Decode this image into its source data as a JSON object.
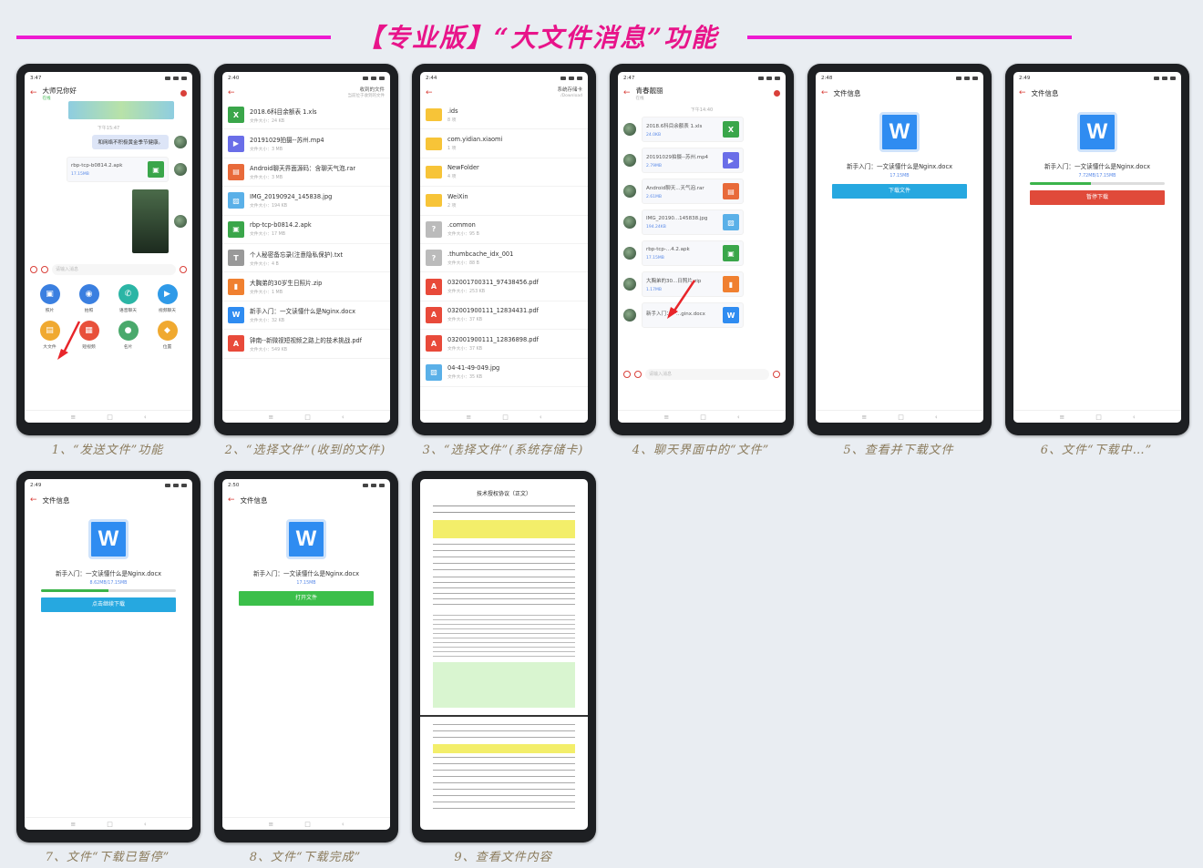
{
  "banner": {
    "title": "【专业版】“大文件消息”功能"
  },
  "captions": [
    "1、“发送文件”功能",
    "2、“选择文件”(收到的文件)",
    "3、“选择文件”(系统存储卡)",
    "4、聊天界面中的“文件”",
    "5、查看并下载文件",
    "6、文件“下载中…”",
    "7、文件“下载已暂停”",
    "8、文件“下载完成”",
    "9、查看文件内容"
  ],
  "nav": {
    "menu": "≡",
    "home": "□",
    "back": "‹"
  },
  "screen1": {
    "clock": "3:47",
    "title": "大师兄你好",
    "subtitle": "在线",
    "time": "下午15:47",
    "text_msg": "和网络不积极黄金季节健康。",
    "file_name": "rbp-tcp-b0814.2.apk",
    "file_size": "17.15MB",
    "input_placeholder": "请输入消息",
    "actions": [
      {
        "label": "照片",
        "color": "#3a7fe0",
        "glyph": "▣"
      },
      {
        "label": "拍照",
        "color": "#3a7fe0",
        "glyph": "◉"
      },
      {
        "label": "语音聊天",
        "color": "#2bb5a5",
        "glyph": "✆"
      },
      {
        "label": "视频聊天",
        "color": "#2f9ae8",
        "glyph": "▶"
      },
      {
        "label": "大文件",
        "color": "#f0a930",
        "glyph": "▤"
      },
      {
        "label": "短视频",
        "color": "#e8503a",
        "glyph": "▦"
      },
      {
        "label": "名片",
        "color": "#4aa96c",
        "glyph": "●"
      },
      {
        "label": "位置",
        "color": "#f0a930",
        "glyph": "◆"
      }
    ]
  },
  "screen2": {
    "clock": "2:40",
    "title": "收到的文件",
    "subtitle": "当前位于收到的文件",
    "files": [
      {
        "name": "2018.6科目余额表 1.xls",
        "size": "文件大小：24 KB",
        "color": "#3aa64a",
        "glyph": "X"
      },
      {
        "name": "20191029拍摄--苏州.mp4",
        "size": "文件大小：3 MB",
        "color": "#6a6ee8",
        "glyph": "▶"
      },
      {
        "name": "Android聊天界面源码：含聊天气泡.rar",
        "size": "文件大小：3 MB",
        "color": "#e86a3a",
        "glyph": "▤"
      },
      {
        "name": "IMG_20190924_145838.jpg",
        "size": "文件大小：194 KB",
        "color": "#5ab0e8",
        "glyph": "▨"
      },
      {
        "name": "rbp-tcp-b0814.2.apk",
        "size": "文件大小：17 MB",
        "color": "#3aa64a",
        "glyph": "▣"
      },
      {
        "name": "个人秘密备忘录(注意隐私保护).txt",
        "size": "文件大小：4 B",
        "color": "#999999",
        "glyph": "T"
      },
      {
        "name": "大胸弟的30岁生日照片.zip",
        "size": "文件大小：1 MB",
        "color": "#f08030",
        "glyph": "▮"
      },
      {
        "name": "新手入门：一文读懂什么是Nginx.docx",
        "size": "文件大小：32 KB",
        "color": "#2f8cf1",
        "glyph": "W"
      },
      {
        "name": "钟南--新微视短视频之路上的技术挑战.pdf",
        "size": "文件大小：549 KB",
        "color": "#e84a3a",
        "glyph": "A"
      }
    ]
  },
  "screen3": {
    "clock": "2:44",
    "title": "系统存储卡",
    "subtitle": "/Download",
    "files": [
      {
        "name": ".ids",
        "size": "8 项",
        "kind": "folder"
      },
      {
        "name": "com.yidian.xiaomi",
        "size": "1 项",
        "kind": "folder"
      },
      {
        "name": "NewFolder",
        "size": "4 项",
        "kind": "folder"
      },
      {
        "name": "WeiXin",
        "size": "2 项",
        "kind": "folder"
      },
      {
        "name": ".common",
        "size": "文件大小：95 B",
        "kind": "file",
        "color": "#bbbbbb",
        "glyph": "?"
      },
      {
        "name": ".thumbcache_idx_001",
        "size": "文件大小：88 B",
        "kind": "file",
        "color": "#bbbbbb",
        "glyph": "?"
      },
      {
        "name": "032001700311_97438456.pdf",
        "size": "文件大小：253 KB",
        "kind": "file",
        "color": "#e84a3a",
        "glyph": "A"
      },
      {
        "name": "032001900111_12834431.pdf",
        "size": "文件大小：37 KB",
        "kind": "file",
        "color": "#e84a3a",
        "glyph": "A"
      },
      {
        "name": "032001900111_12836898.pdf",
        "size": "文件大小：37 KB",
        "kind": "file",
        "color": "#e84a3a",
        "glyph": "A"
      },
      {
        "name": "04-41-49-049.jpg",
        "size": "文件大小：35 KB",
        "kind": "file",
        "color": "#5ab0e8",
        "glyph": "▨"
      }
    ]
  },
  "screen4": {
    "clock": "2:47",
    "title": "青春靓丽",
    "subtitle": "在线",
    "time": "下午14:40",
    "input_placeholder": "请输入消息",
    "files": [
      {
        "name": "2018.6科目余额表 1.xls",
        "size": "24.0KB",
        "color": "#3aa64a",
        "glyph": "X"
      },
      {
        "name": "20191029拍摄--苏州.mp4",
        "size": "2.79MB",
        "color": "#6a6ee8",
        "glyph": "▶"
      },
      {
        "name": "Android聊天...天气泡.rar",
        "size": "2.61MB",
        "color": "#e86a3a",
        "glyph": "▤"
      },
      {
        "name": "IMG_20190...145838.jpg",
        "size": "194.24KB",
        "color": "#5ab0e8",
        "glyph": "▨"
      },
      {
        "name": "rbp-tcp-...4.2.apk",
        "size": "17.15MB",
        "color": "#3aa64a",
        "glyph": "▣"
      },
      {
        "name": "大胸弟的30...日照片.zip",
        "size": "1.17MB",
        "color": "#f08030",
        "glyph": "▮"
      },
      {
        "name": "新手入门：一...ginx.docx",
        "size": "",
        "color": "#2f8cf1",
        "glyph": "W"
      }
    ]
  },
  "fileinfo": {
    "title": "文件信息",
    "file_name": "新手入门：一文读懂什么是Nginx.docx",
    "glyph": "W",
    "s5": {
      "clock": "2:48",
      "size": "17.15MB",
      "button": "下载文件",
      "color": "#26a8e0"
    },
    "s6": {
      "clock": "2:49",
      "size": "7.72MB/17.15MB",
      "button": "暂停下载",
      "color": "#e04a3a",
      "progress": 0.45
    },
    "s7": {
      "clock": "2:49",
      "size": "8.62MB/17.15MB",
      "button": "点击继续下载",
      "color": "#26a8e0",
      "progress": 0.5
    },
    "s8": {
      "clock": "2:50",
      "size": "17.15MB",
      "button": "打开文件",
      "color": "#3bbf4a"
    }
  },
  "doc": {
    "title": "技术授权协议（正文）"
  }
}
